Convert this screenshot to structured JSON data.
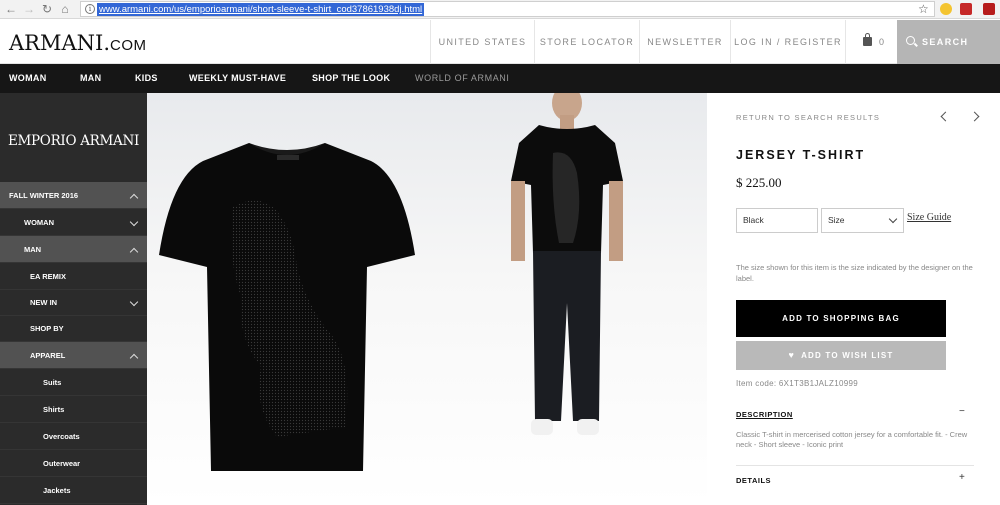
{
  "browser": {
    "url": "www.armani.com/us/emporioarmani/short-sleeve-t-shirt_cod37861938dj.html"
  },
  "header": {
    "logo_main": "ARMANI.",
    "logo_suffix": "COM",
    "links": [
      "UNITED STATES",
      "STORE LOCATOR",
      "NEWSLETTER",
      "LOG IN / REGISTER"
    ],
    "bag_count": "0",
    "search_label": "SEARCH"
  },
  "nav": {
    "items": [
      "WOMAN",
      "MAN",
      "KIDS",
      "WEEKLY MUST-HAVE",
      "SHOP THE LOOK",
      "WORLD OF ARMANI"
    ]
  },
  "sidebar": {
    "brand_logo": "EMPORIO ARMANI",
    "items": [
      {
        "label": "FALL WINTER 2016"
      },
      {
        "label": "WOMAN"
      },
      {
        "label": "MAN"
      },
      {
        "label": "EA REMIX"
      },
      {
        "label": "NEW IN"
      },
      {
        "label": "SHOP BY"
      },
      {
        "label": "APPAREL"
      },
      {
        "label": "Suits"
      },
      {
        "label": "Shirts"
      },
      {
        "label": "Overcoats"
      },
      {
        "label": "Outerwear"
      },
      {
        "label": "Jackets"
      }
    ]
  },
  "product": {
    "back_link": "RETURN TO SEARCH RESULTS",
    "title": "JERSEY T-SHIRT",
    "price": "$ 225.00",
    "color_value": "Black",
    "size_placeholder": "Size",
    "size_guide": "Size Guide",
    "size_note": "The size shown for this item is the size indicated by the designer on the label.",
    "add_to_bag": "ADD TO SHOPPING BAG",
    "add_to_wishlist": "ADD TO WISH LIST",
    "item_code": "Item code: 6X1T3B1JALZ10999",
    "description_label": "DESCRIPTION",
    "description_toggle": "−",
    "description_text": "Classic T-shirt in mercerised cotton jersey for a comfortable fit. - Crew neck - Short sleeve - Iconic print",
    "details_label": "DETAILS",
    "details_toggle": "+"
  },
  "icons": {
    "back": "arrow-left",
    "forward": "arrow-right",
    "reload": "reload",
    "home": "home",
    "info": "info",
    "bookmark": "star",
    "bag": "shopping-bag",
    "search": "magnifier",
    "heart": "heart"
  },
  "colors": {
    "nav_bg": "#161616",
    "sidebar_bg": "#2b2b2b",
    "sidebar_active": "#525252",
    "search_bg": "#b5b5b5",
    "bag_button": "#000000",
    "wishlist_button": "#b9b9b9",
    "url_highlight": "#3367d6"
  }
}
